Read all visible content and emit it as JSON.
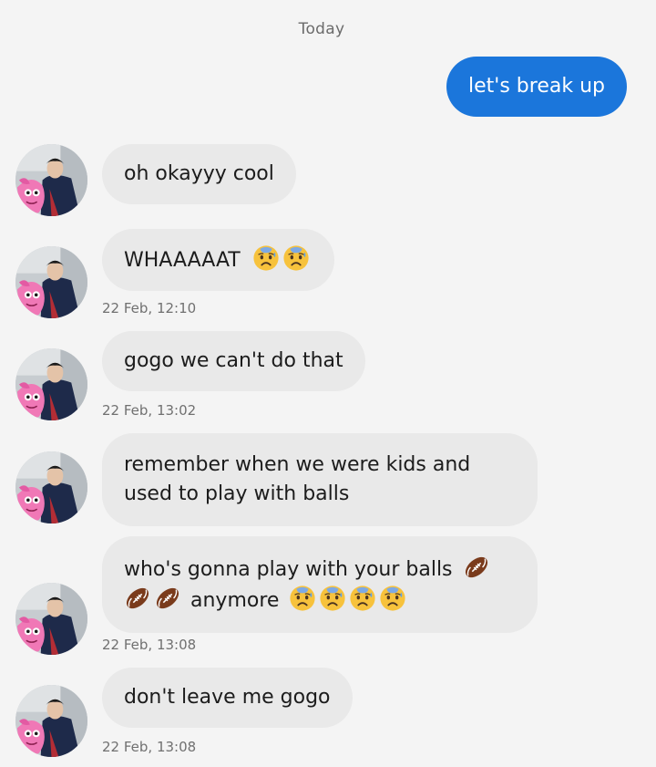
{
  "date_separator": "Today",
  "messages": [
    {
      "direction": "outgoing",
      "text": "let's break up"
    },
    {
      "direction": "incoming",
      "text": "oh okayyy cool"
    },
    {
      "direction": "incoming",
      "text": "WHAAAAAT",
      "emojis": [
        "sad-sweat-face",
        "sad-sweat-face"
      ],
      "time": "22 Feb, 12:10"
    },
    {
      "direction": "incoming",
      "text": "gogo we can't do that",
      "time": "22 Feb, 13:02"
    },
    {
      "direction": "incoming",
      "text": "remember when we were kids and used to play with balls"
    },
    {
      "direction": "incoming",
      "text_a": "who's gonna play with your balls",
      "text_b": "anymore",
      "emojis": [
        "american-football",
        "american-football",
        "american-football",
        "sad-sweat-face",
        "sad-sweat-face",
        "sad-sweat-face",
        "sad-sweat-face"
      ],
      "time": "22 Feb, 13:08"
    },
    {
      "direction": "incoming",
      "text": "don't leave me gogo",
      "time": "22 Feb, 13:08"
    }
  ],
  "colors": {
    "background": "#f4f4f4",
    "incoming_bubble": "#e9e9e9",
    "outgoing_bubble": "#1b76db"
  }
}
